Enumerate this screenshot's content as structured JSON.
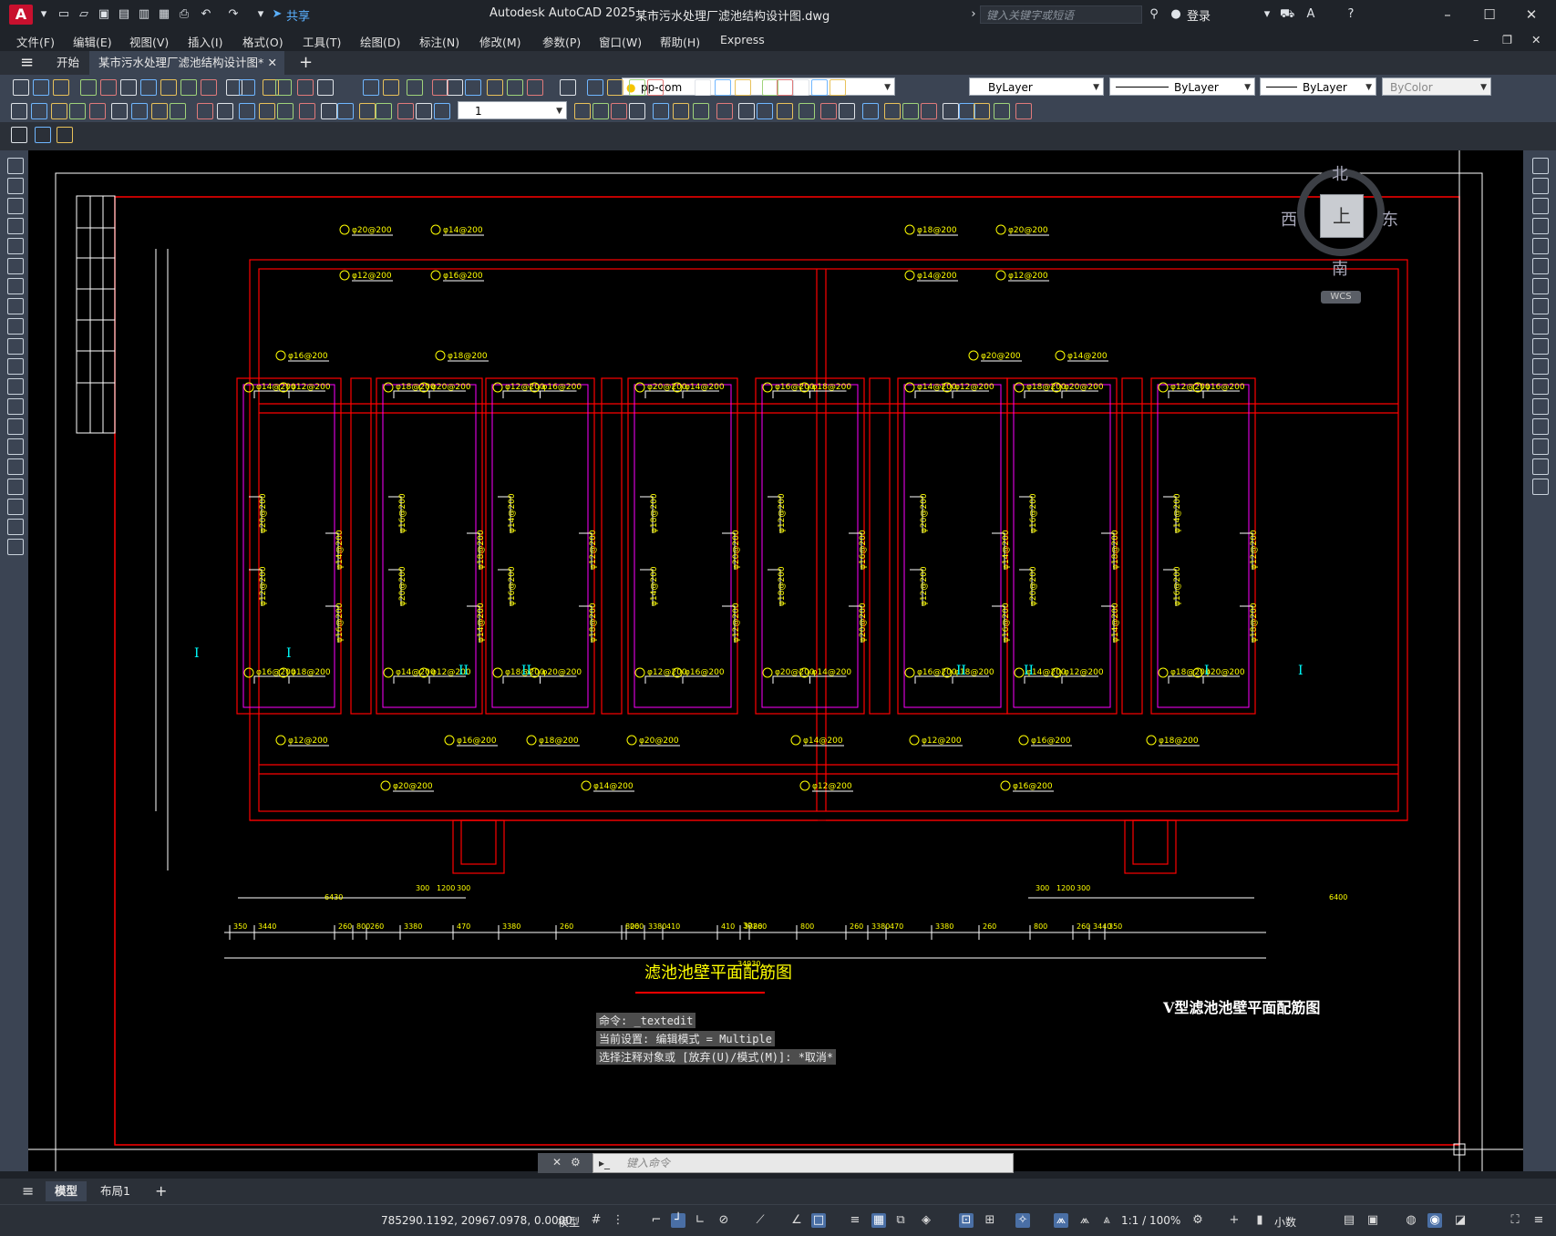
{
  "titlebar": {
    "app_logo": "A",
    "share_label": "共享",
    "app_name": "Autodesk AutoCAD 2025",
    "file_name": "某市污水处理厂滤池结构设计图.dwg",
    "search_placeholder": "键入关键字或短语",
    "login_label": "登录"
  },
  "menu": [
    "文件(F)",
    "编辑(E)",
    "视图(V)",
    "插入(I)",
    "格式(O)",
    "工具(T)",
    "绘图(D)",
    "标注(N)",
    "修改(M)",
    "参数(P)",
    "窗口(W)",
    "帮助(H)",
    "Express"
  ],
  "tabs": {
    "start": "开始",
    "active_doc": "某市污水处理厂滤池结构设计图*"
  },
  "properties": {
    "layer": "pp-com",
    "color": "ByLayer",
    "linetype": "ByLayer",
    "lineweight": "ByLayer",
    "plotstyle": "ByColor",
    "dim_scale": "1"
  },
  "drawing": {
    "main_title": "滤池池壁平面配筋图",
    "corner_title": "V型滤池池壁平面配筋图",
    "rebar_labels": [
      "φ14@200",
      "φ12@200",
      "φ16@200",
      "φ18@200",
      "φ20@200"
    ],
    "dims_bottom": [
      "350",
      "3440",
      "260",
      "800",
      "260",
      "3380",
      "470",
      "3380",
      "260",
      "800",
      "260",
      "3380",
      "410",
      "410",
      "3380",
      "260",
      "800",
      "260",
      "3380",
      "470",
      "3380",
      "260",
      "800",
      "260",
      "3440",
      "350"
    ],
    "total_dim": "34930",
    "dims_top_left": [
      "6430",
      "300",
      "1200",
      "300"
    ],
    "dims_top_right": [
      "300",
      "1200",
      "300",
      "6400"
    ],
    "center_dim": "30",
    "section_marks": [
      "I",
      "I",
      "II",
      "II",
      "II",
      "II",
      "I",
      "I"
    ]
  },
  "viewcube": {
    "north": "北",
    "south": "南",
    "east": "东",
    "west": "西",
    "face": "上",
    "wcs": "WCS"
  },
  "command": {
    "history": [
      "命令: _textedit",
      "当前设置: 编辑模式 = Multiple",
      "选择注释对象或 [放弃(U)/模式(M)]: *取消*"
    ],
    "placeholder": "键入命令"
  },
  "layouts": [
    "模型",
    "布局1"
  ],
  "status": {
    "coords": "785290.1192, 20967.0978, 0.0000",
    "model": "模型",
    "scale": "1:1 / 100%",
    "units": "小数"
  },
  "colors": {
    "canvas_bg": "#000000",
    "wall_red": "#ff0000",
    "inner_magenta": "#ff00ff",
    "label_yellow": "#ffff00",
    "white_lines": "#ffffff",
    "cyan_marks": "#00ffff"
  }
}
